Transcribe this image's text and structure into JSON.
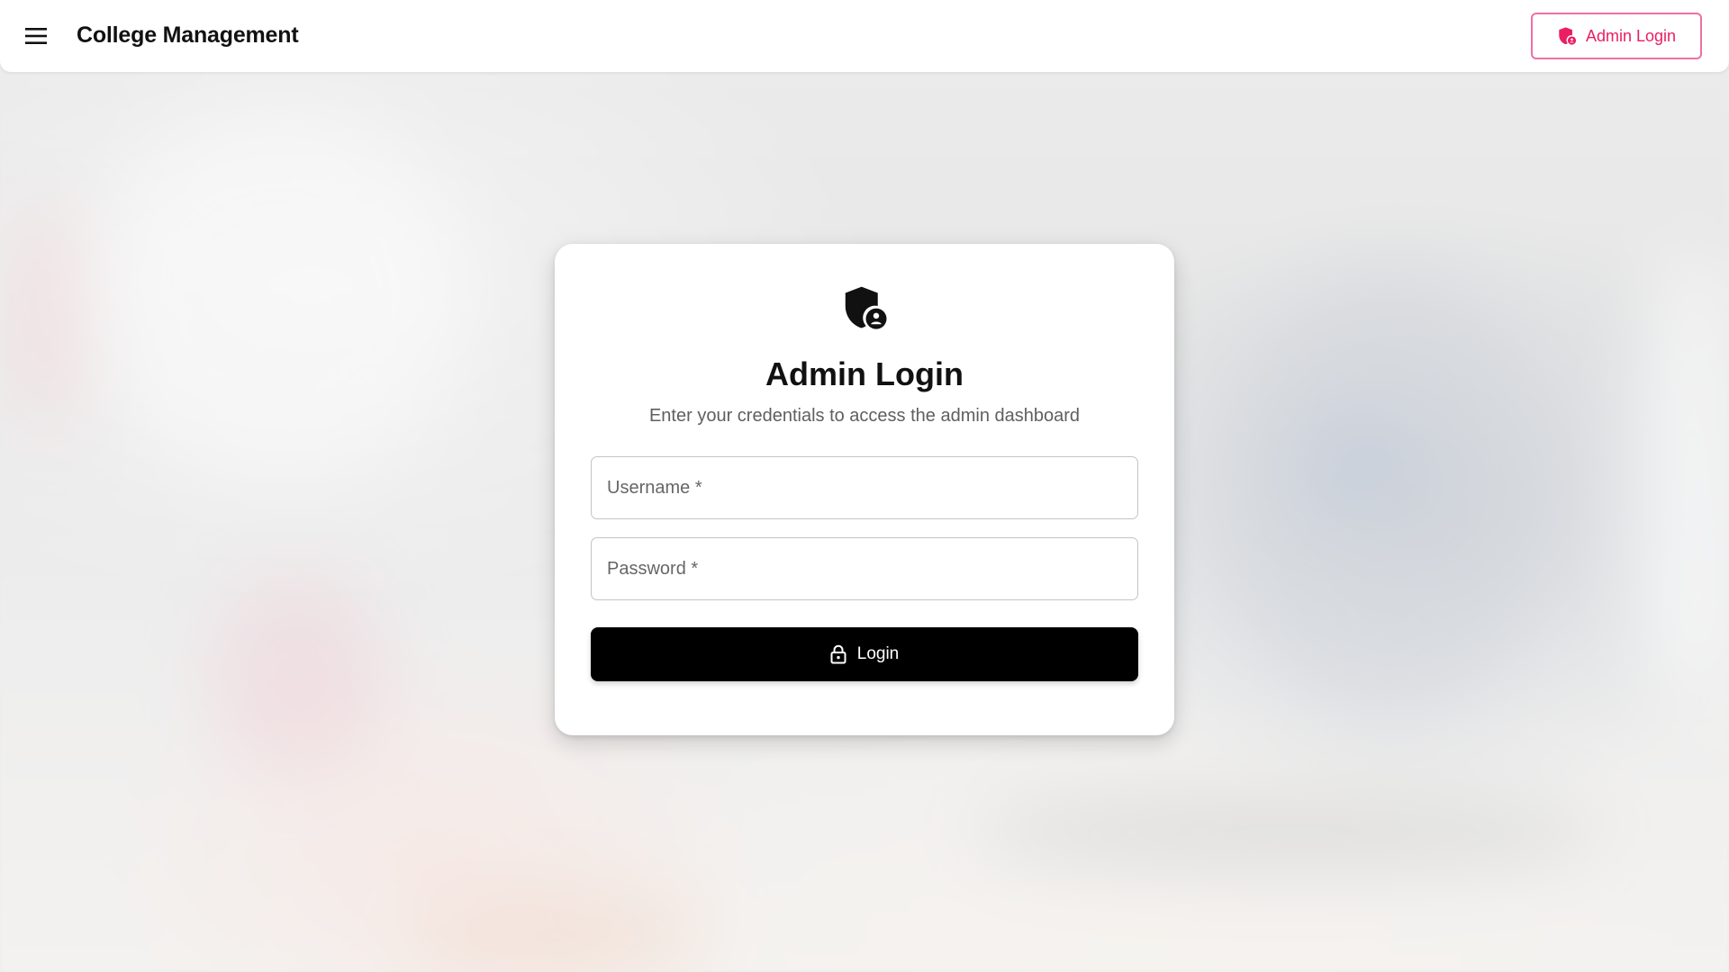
{
  "header": {
    "app_title": "College Management",
    "menu_icon": "hamburger-menu-icon",
    "admin_login_label": "Admin Login",
    "admin_login_icon": "admin-shield-icon",
    "accent_color": "#e91e63"
  },
  "login_card": {
    "icon": "admin-shield-icon",
    "title": "Admin Login",
    "subtitle": "Enter your credentials to access the admin dashboard",
    "username": {
      "placeholder": "Username *",
      "value": ""
    },
    "password": {
      "placeholder": "Password *",
      "value": ""
    },
    "login_button": {
      "label": "Login",
      "icon": "lock-icon",
      "background": "#000000"
    }
  }
}
